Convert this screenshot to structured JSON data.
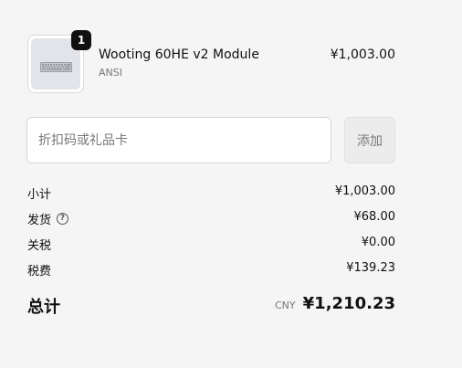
{
  "cart_item": {
    "quantity": "1",
    "name": "Wooting 60HE v2 Module",
    "variant": "ANSI",
    "price": "¥1,003.00",
    "thumbnail_icon": "keyboard-icon"
  },
  "discount": {
    "placeholder": "折扣码或礼品卡",
    "value": "",
    "apply_label": "添加"
  },
  "summary": {
    "subtotal_label": "小计",
    "subtotal_value": "¥1,003.00",
    "shipping_label": "发货",
    "shipping_value": "¥68.00",
    "duties_label": "关税",
    "duties_value": "¥0.00",
    "tax_label": "税费",
    "tax_value": "¥139.23"
  },
  "total": {
    "label": "总计",
    "currency": "CNY",
    "amount": "¥1,210.23"
  },
  "colors": {
    "background": "#f5f5f5",
    "badge": "#111111",
    "thumbnail_bg": "#e3e4e9",
    "button_bg": "#ececec"
  }
}
